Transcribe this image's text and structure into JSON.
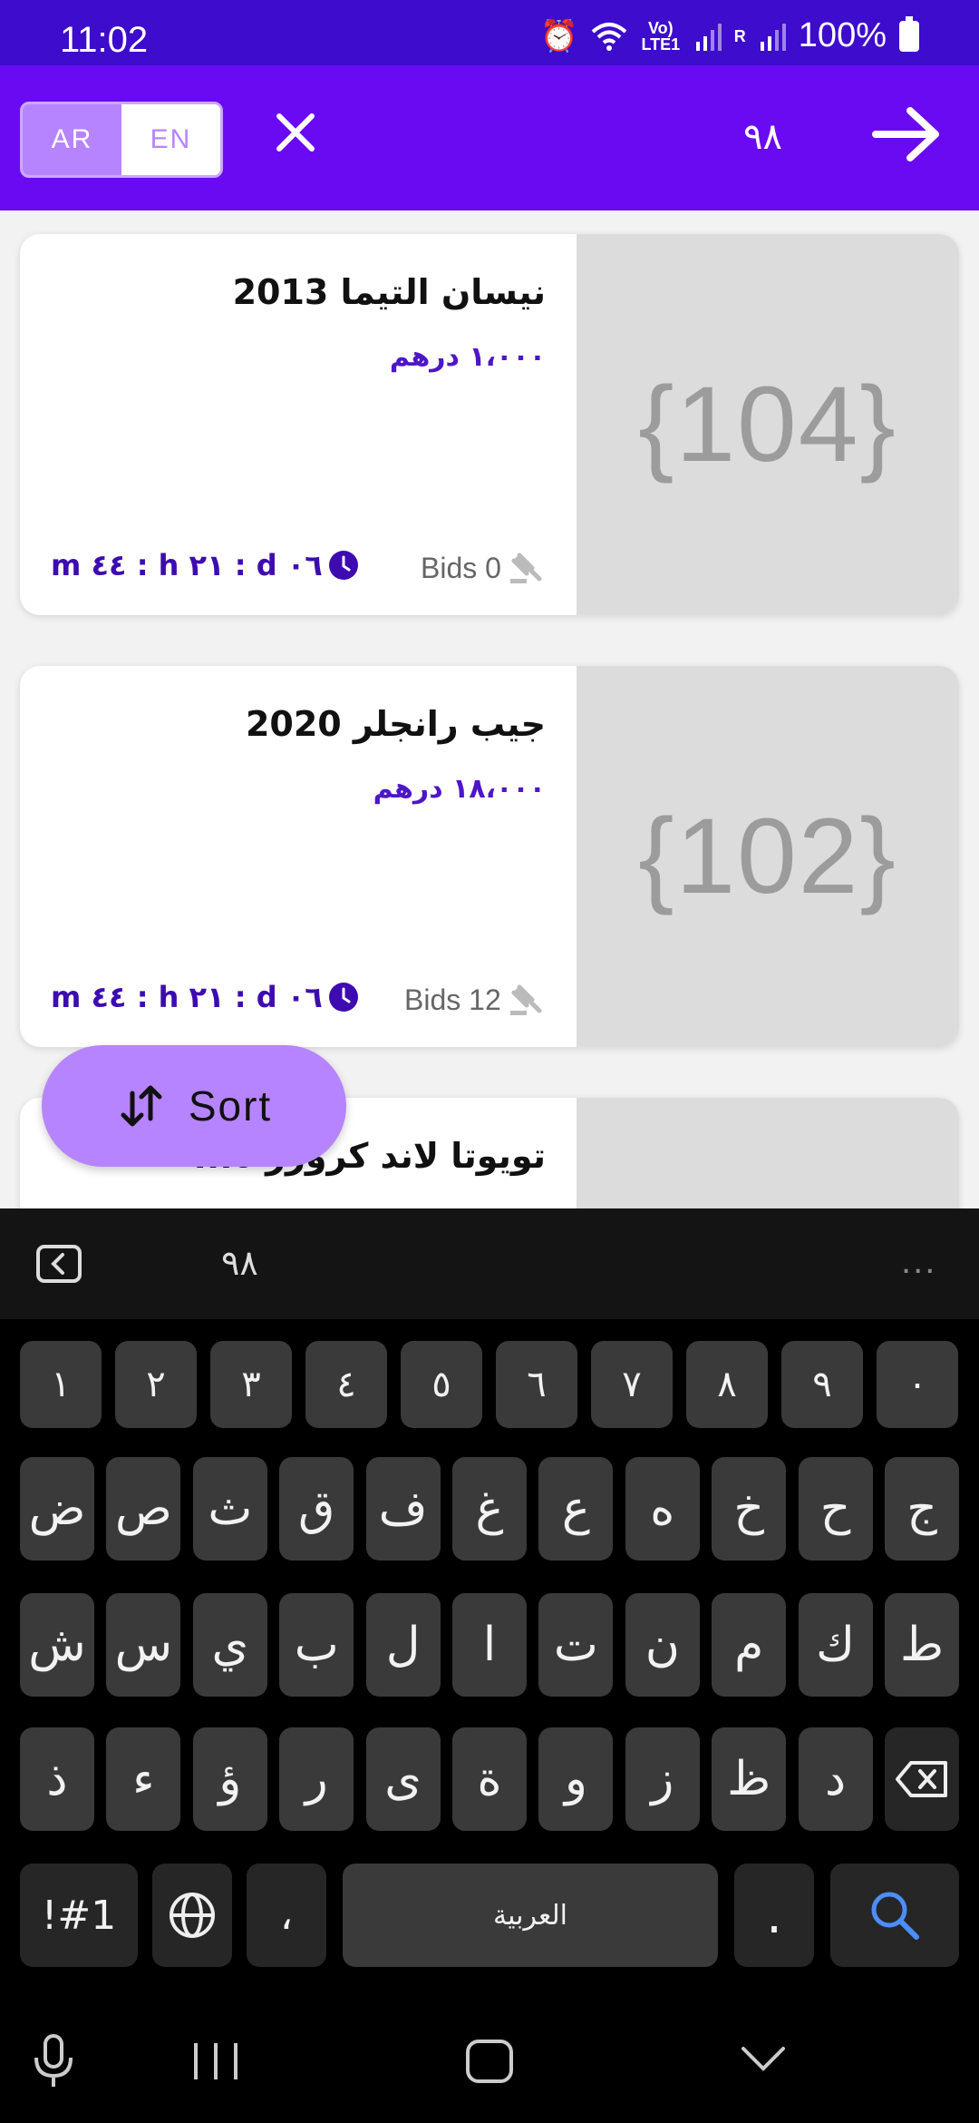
{
  "status_bar": {
    "time": "11:02",
    "battery": "100%",
    "network_small": "Vo) LTE1",
    "roaming": "R"
  },
  "app_bar": {
    "lang_ar": "AR",
    "lang_en": "EN",
    "search_value": "٩٨",
    "accent_color": "#6a0af2"
  },
  "listings": [
    {
      "title": "نيسان التيما 2013",
      "price": "١،٠٠٠ درهم",
      "image_placeholder": "{104}",
      "bids": "Bids 0",
      "timer": "m ٤٤ : h ٢١ : d ٠٦"
    },
    {
      "title": "جيب رانجلر 2020",
      "price": "١٨،٠٠٠ درهم",
      "image_placeholder": "{102}",
      "bids": "Bids 12",
      "timer": "m ٤٤ : h ٢١ : d ٠٦"
    },
    {
      "title": "تويوتا لاند كروزر ٥..."
    }
  ],
  "sort_button": {
    "label": "Sort"
  },
  "keyboard": {
    "suggestion": "٩٨",
    "more": "...",
    "number_row": [
      "١",
      "٢",
      "٣",
      "٤",
      "٥",
      "٦",
      "٧",
      "٨",
      "٩",
      "٠"
    ],
    "row1": [
      "ض",
      "ص",
      "ث",
      "ق",
      "ف",
      "غ",
      "ع",
      "ه",
      "خ",
      "ح",
      "ج"
    ],
    "row2": [
      "ش",
      "س",
      "ي",
      "ب",
      "ل",
      "ا",
      "ت",
      "ن",
      "م",
      "ك",
      "ط"
    ],
    "row3": [
      "ذ",
      "ء",
      "ؤ",
      "ر",
      "ى",
      "ة",
      "و",
      "ز",
      "ظ",
      "د"
    ],
    "symbols_key": "!#1",
    "comma_key": "،",
    "space_label": "العربية",
    "period_key": "."
  }
}
